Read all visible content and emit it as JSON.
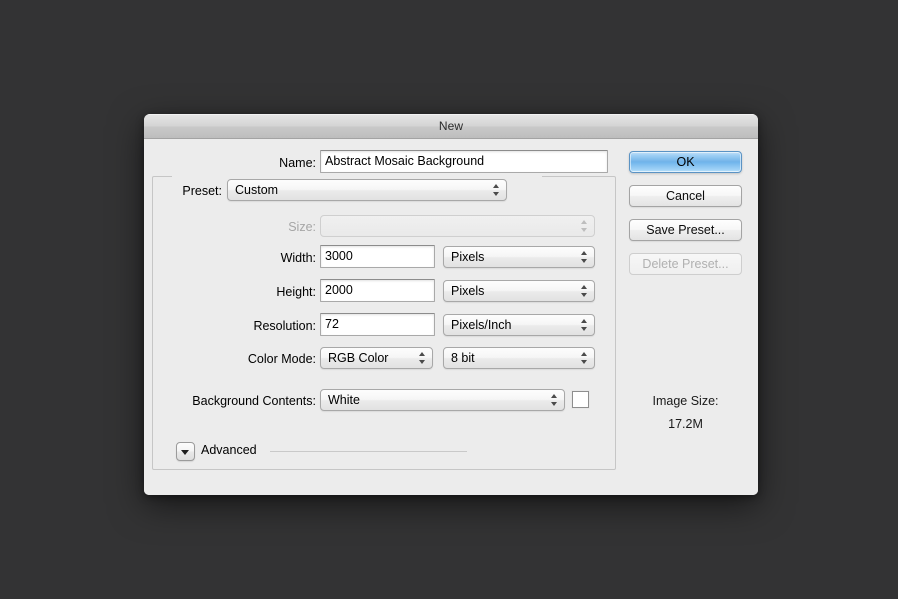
{
  "window": {
    "title": "New",
    "background_color": "#333334",
    "dialog_color": "#ececec"
  },
  "form": {
    "name": {
      "label": "Name:",
      "value": "Abstract Mosaic Background",
      "placeholder": "Untitled-1"
    },
    "preset": {
      "label": "Preset:",
      "value": "Custom"
    },
    "size": {
      "label": "Size:",
      "value": "",
      "disabled": true
    },
    "width": {
      "label": "Width:",
      "value": "3000",
      "unit": "Pixels"
    },
    "height": {
      "label": "Height:",
      "value": "2000",
      "unit": "Pixels"
    },
    "resolution": {
      "label": "Resolution:",
      "value": "72",
      "unit": "Pixels/Inch"
    },
    "color_mode": {
      "label": "Color Mode:",
      "value": "RGB Color",
      "depth": "8 bit"
    },
    "background_contents": {
      "label": "Background Contents:",
      "value": "White",
      "swatch_color": "#ffffff"
    },
    "advanced": {
      "label": "Advanced",
      "expanded": false,
      "icon": "disclosure-triangle-down-icon"
    }
  },
  "buttons": {
    "ok": "OK",
    "cancel": "Cancel",
    "save_preset": "Save Preset...",
    "delete_preset": "Delete Preset...",
    "delete_preset_disabled": true,
    "default_accent": "#6fb2e8"
  },
  "image_size": {
    "label": "Image Size:",
    "value": "17.2M"
  },
  "icons": {
    "stepper": "up-down-stepper-arrows-icon"
  }
}
